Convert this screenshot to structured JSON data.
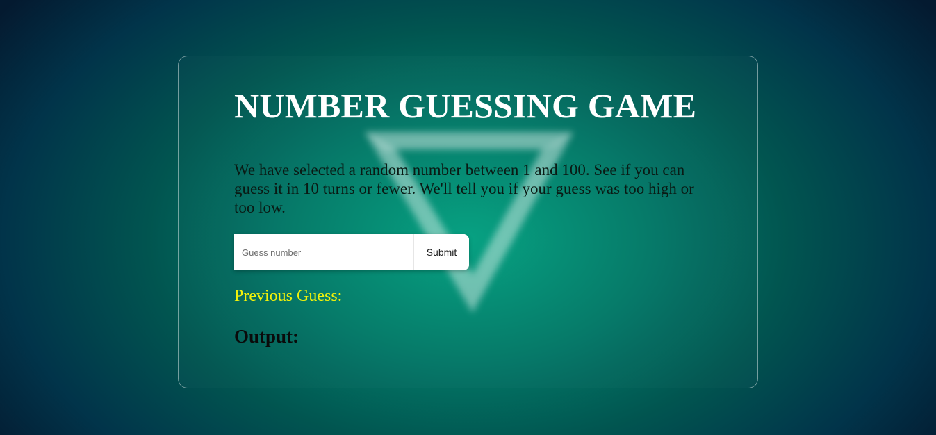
{
  "game": {
    "title": "NUMBER GUESSING GAME",
    "description": "We have selected a random number between 1 and 100. See if you can guess it in 10 turns or fewer. We'll tell you if your guess was too high or too low.",
    "input": {
      "placeholder": "Guess number",
      "value": ""
    },
    "submit_label": "Submit",
    "previous_guess_label": "Previous Guess:",
    "output_label": "Output:"
  },
  "colors": {
    "background_center": "#03a080",
    "background_edge": "#041a30",
    "title": "#ffffff",
    "previous_guess": "#f2f20a",
    "text": "#0a1a14"
  },
  "icons": {
    "background_graphic": "penrose-triangle-icon"
  }
}
